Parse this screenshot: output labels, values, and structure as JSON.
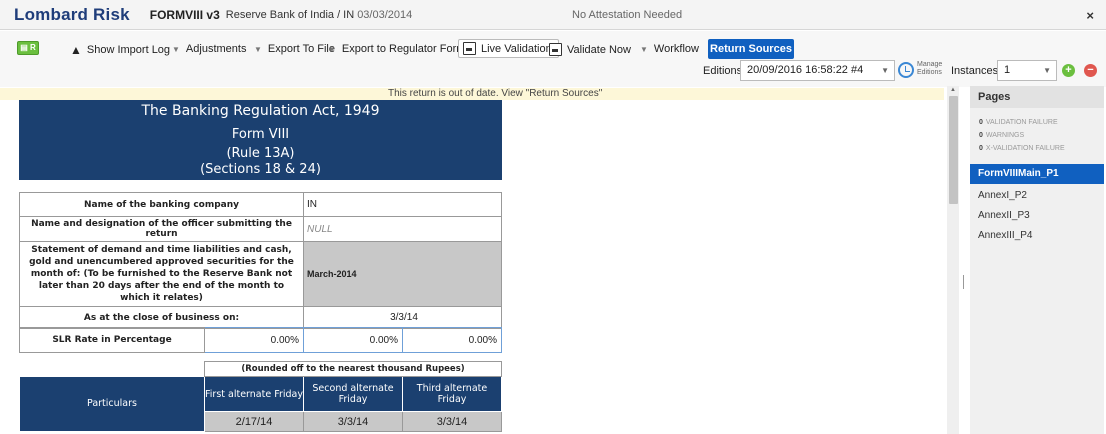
{
  "titlebar": {
    "brand": "Lombard Risk",
    "form_code": "FORMVIII v3",
    "form_desc": "Reserve Bank of India / IN",
    "form_date": "03/03/2014",
    "attestation": "No Attestation Needed",
    "close": "×"
  },
  "toolbar": {
    "badge": "▤ R",
    "import_log": "Show Import Log",
    "adjustments": "Adjustments",
    "export_file": "Export To File",
    "export_regulator": "Export to Regulator Format",
    "live_validation": "Live Validation",
    "validate_now": "Validate Now",
    "workflow": "Workflow",
    "return_sources": "Return Sources",
    "editions_label": "Editions",
    "editions_value": "20/09/2016 16:58:22 #4",
    "manage_editions": "Manage Editions",
    "instances_label": "Instances",
    "instances_value": "1"
  },
  "notice": "This return is out of date. View \"Return Sources\"",
  "form": {
    "header": {
      "line1": "The Banking Regulation Act, 1949",
      "line2": "Form VIII",
      "line3": "(Rule 13A)",
      "line4": "(Sections 18 & 24)"
    },
    "rows": {
      "bank_name_label": "Name of the banking company",
      "bank_name_value": "IN",
      "officer_label": "Name and designation of the officer submitting the return",
      "officer_value": "NULL",
      "statement_label": "Statement of demand and time liabilities and cash, gold and unencumbered approved securities for the month of: (To be furnished to the Reserve Bank not later than 20 days after the end of the month to which it relates)",
      "statement_value": "March-2014",
      "close_label": "As at the close of business on:",
      "close_value": "3/3/14",
      "slr_label": "SLR Rate in Percentage",
      "slr_values": [
        "0.00%",
        "0.00%",
        "0.00%"
      ]
    },
    "particulars": {
      "rounded_note": "(Rounded off to the nearest thousand Rupees)",
      "particulars_label": "Particulars",
      "col1": "First alternate Friday",
      "col2": "Second alternate Friday",
      "col3": "Third alternate Friday",
      "dates": [
        "2/17/14",
        "3/3/14",
        "3/3/14"
      ]
    }
  },
  "pages_panel": {
    "title": "Pages",
    "stats": [
      {
        "count": "0",
        "label": "VALIDATION FAILURE"
      },
      {
        "count": "0",
        "label": "WARNINGS"
      },
      {
        "count": "0",
        "label": "X-VALIDATION FAILURE"
      }
    ],
    "items": [
      "FormVIIIMain_P1",
      "AnnexI_P2",
      "AnnexII_P3",
      "AnnexIII_P4"
    ],
    "active_index": 0
  },
  "colors": {
    "brand": "#1f3d7a",
    "header_blue": "#1b4070",
    "accent": "#1060c0",
    "notice_bg": "#fdf7d8"
  },
  "icons": [
    "close-icon",
    "warning-icon",
    "caret-down-icon",
    "document-icon",
    "clock-icon",
    "add-icon",
    "remove-icon"
  ]
}
